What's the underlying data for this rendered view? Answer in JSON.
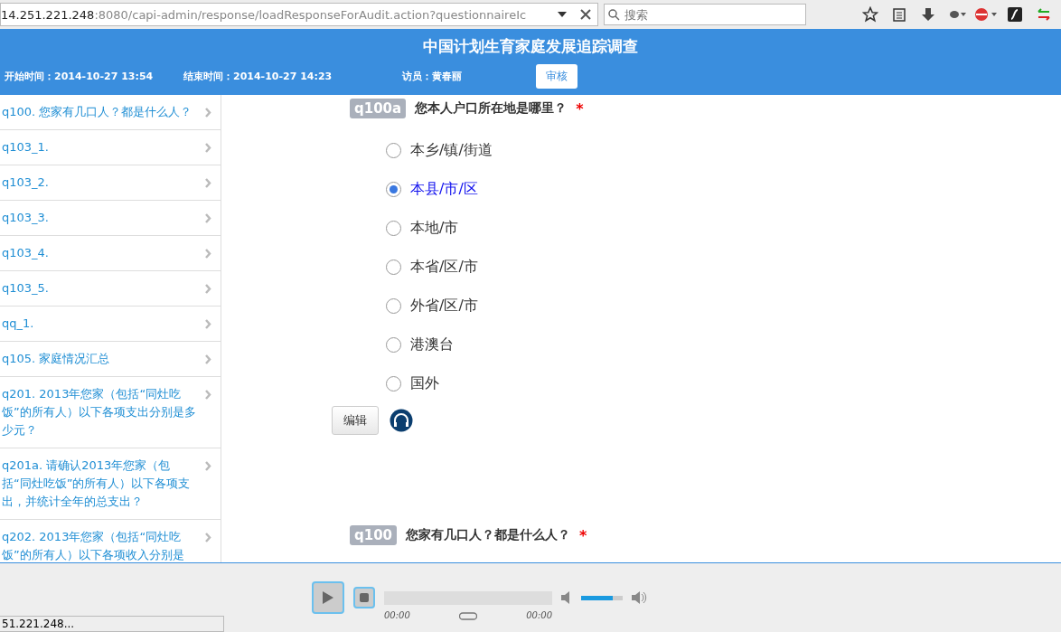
{
  "browser": {
    "url_host": "14.251.221.248",
    "url_rest": ":8080/capi-admin/response/loadResponseForAudit.action?questionnaireIc",
    "search_placeholder": "搜索"
  },
  "header": {
    "title": "中国计划生育家庭发展追踪调查",
    "start": "开始时间：2014-10-27 13:54",
    "end": "结束时间：2014-10-27 14:23",
    "interviewer": "访员：黄春丽",
    "audit_button": "审核"
  },
  "sidebar": {
    "items": [
      {
        "label": "q100. 您家有几口人？都是什么人？"
      },
      {
        "label": "q103_1."
      },
      {
        "label": "q103_2."
      },
      {
        "label": "q103_3."
      },
      {
        "label": "q103_4."
      },
      {
        "label": "q103_5."
      },
      {
        "label": "qq_1."
      },
      {
        "label": "q105. 家庭情况汇总"
      },
      {
        "label": "q201. 2013年您家（包括“同灶吃饭”的所有人）以下各项支出分别是多少元？"
      },
      {
        "label": "q201a. 请确认2013年您家（包括“同灶吃饭”的所有人）以下各项支出，并统计全年的总支出？"
      },
      {
        "label": "q202. 2013年您家（包括“同灶吃饭”的所有人）以下各项收入分别是"
      }
    ]
  },
  "questions": [
    {
      "code": "q100a",
      "text": "您本人户口所在地是哪里？",
      "required_mark": "*",
      "options": [
        {
          "label": "本乡/镇/街道",
          "selected": false
        },
        {
          "label": "本县/市/区",
          "selected": true
        },
        {
          "label": "本地/市",
          "selected": false
        },
        {
          "label": "本省/区/市",
          "selected": false
        },
        {
          "label": "外省/区/市",
          "selected": false
        },
        {
          "label": "港澳台",
          "selected": false
        },
        {
          "label": "国外",
          "selected": false
        }
      ],
      "edit_button": "编辑"
    },
    {
      "code": "q100",
      "text": "您家有几口人？都是什么人？",
      "required_mark": "*"
    }
  ],
  "player": {
    "time_elapsed": "00:00",
    "time_total": "00:00",
    "volume": {
      "level": 0.75
    }
  },
  "status_bar": {
    "text": "51.221.248..."
  }
}
